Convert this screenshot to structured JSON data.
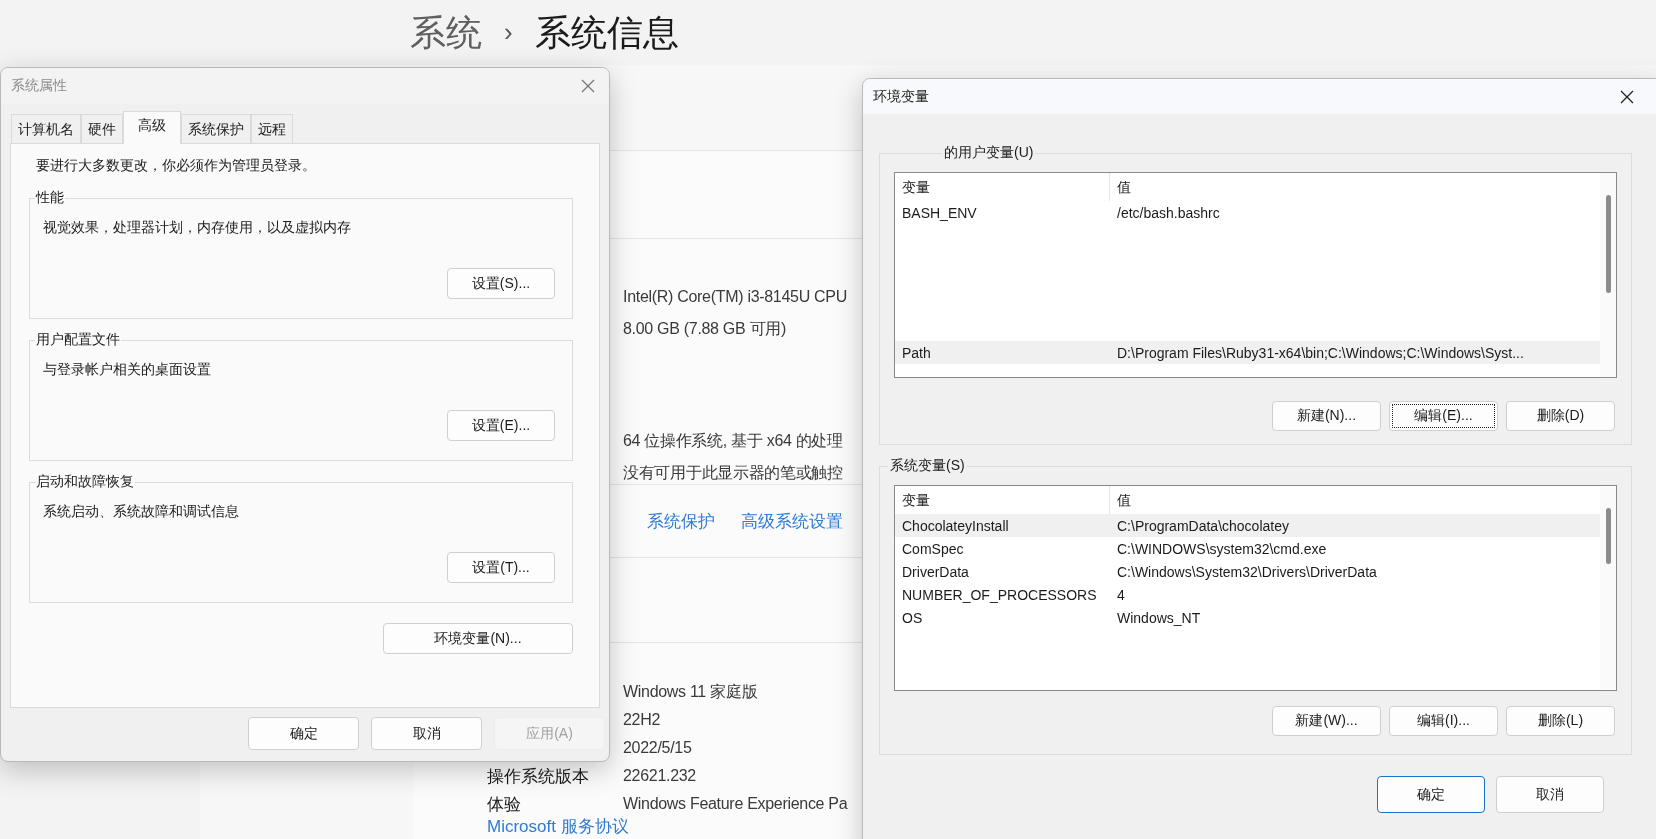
{
  "breadcrumb": {
    "parent": "系统",
    "separator": "›",
    "current": "系统信息"
  },
  "device_specs": {
    "values": [
      "Intel(R) Core(TM) i3-8145U CPU",
      "8.00 GB (7.88 GB 可用)",
      "64 位操作系统, 基于 x64 的处理",
      "没有可用于此显示器的笔或触控"
    ]
  },
  "related_links": [
    "系统保护",
    "高级系统设置"
  ],
  "windows_specs": {
    "rows": [
      {
        "value": "Windows 11 家庭版"
      },
      {
        "value": "22H2"
      },
      {
        "value": "2022/5/15"
      },
      {
        "label": "操作系统版本",
        "value": "22621.232"
      },
      {
        "label": "体验",
        "value": "Windows Feature Experience Pa"
      }
    ],
    "link": "Microsoft 服务协议"
  },
  "system_properties": {
    "title": "系统属性",
    "tabs": [
      {
        "label": "计算机名",
        "selected": false
      },
      {
        "label": "硬件",
        "selected": false
      },
      {
        "label": "高级",
        "selected": true
      },
      {
        "label": "系统保护",
        "selected": false
      },
      {
        "label": "远程",
        "selected": false
      }
    ],
    "notice": "要进行大多数更改，你必须作为管理员登录。",
    "groups": [
      {
        "title": "性能",
        "description": "视觉效果，处理器计划，内存使用，以及虚拟内存",
        "button": "设置(S)..."
      },
      {
        "title": "用户配置文件",
        "description": "与登录帐户相关的桌面设置",
        "button": "设置(E)..."
      },
      {
        "title": "启动和故障恢复",
        "description": "系统启动、系统故障和调试信息",
        "button": "设置(T)..."
      }
    ],
    "env_button": "环境变量(N)...",
    "buttons": [
      {
        "label": "确定",
        "disabled": false
      },
      {
        "label": "取消",
        "disabled": false
      },
      {
        "label": "应用(A)",
        "disabled": true
      }
    ]
  },
  "environment_variables": {
    "title": "环境变量",
    "sections": [
      {
        "legend": "的用户变量(U)",
        "columns": [
          "变量",
          "值"
        ],
        "rows": [
          {
            "name": "BASH_ENV",
            "value": "/etc/bash.bashrc",
            "selected": false
          },
          {
            "name": "Path",
            "value": "D:\\Program Files\\Ruby31-x64\\bin;C:\\Windows;C:\\Windows\\Syst...",
            "selected": true
          }
        ],
        "buttons": [
          {
            "label": "新建(N)...",
            "focused": false
          },
          {
            "label": "编辑(E)...",
            "focused": true
          },
          {
            "label": "删除(D)",
            "focused": false
          }
        ]
      },
      {
        "legend": "系统变量(S)",
        "columns": [
          "变量",
          "值"
        ],
        "rows": [
          {
            "name": "ChocolateyInstall",
            "value": "C:\\ProgramData\\chocolatey",
            "selected": true
          },
          {
            "name": "ComSpec",
            "value": "C:\\WINDOWS\\system32\\cmd.exe",
            "selected": false
          },
          {
            "name": "DriverData",
            "value": "C:\\Windows\\System32\\Drivers\\DriverData",
            "selected": false
          },
          {
            "name": "NUMBER_OF_PROCESSORS",
            "value": "4",
            "selected": false
          },
          {
            "name": "OS",
            "value": "Windows_NT",
            "selected": false
          }
        ],
        "buttons": [
          {
            "label": "新建(W)...",
            "focused": false
          },
          {
            "label": "编辑(I)...",
            "focused": false
          },
          {
            "label": "删除(L)",
            "focused": false
          }
        ]
      }
    ],
    "buttons": [
      {
        "label": "确定",
        "default": true
      },
      {
        "label": "取消",
        "default": false
      }
    ]
  }
}
